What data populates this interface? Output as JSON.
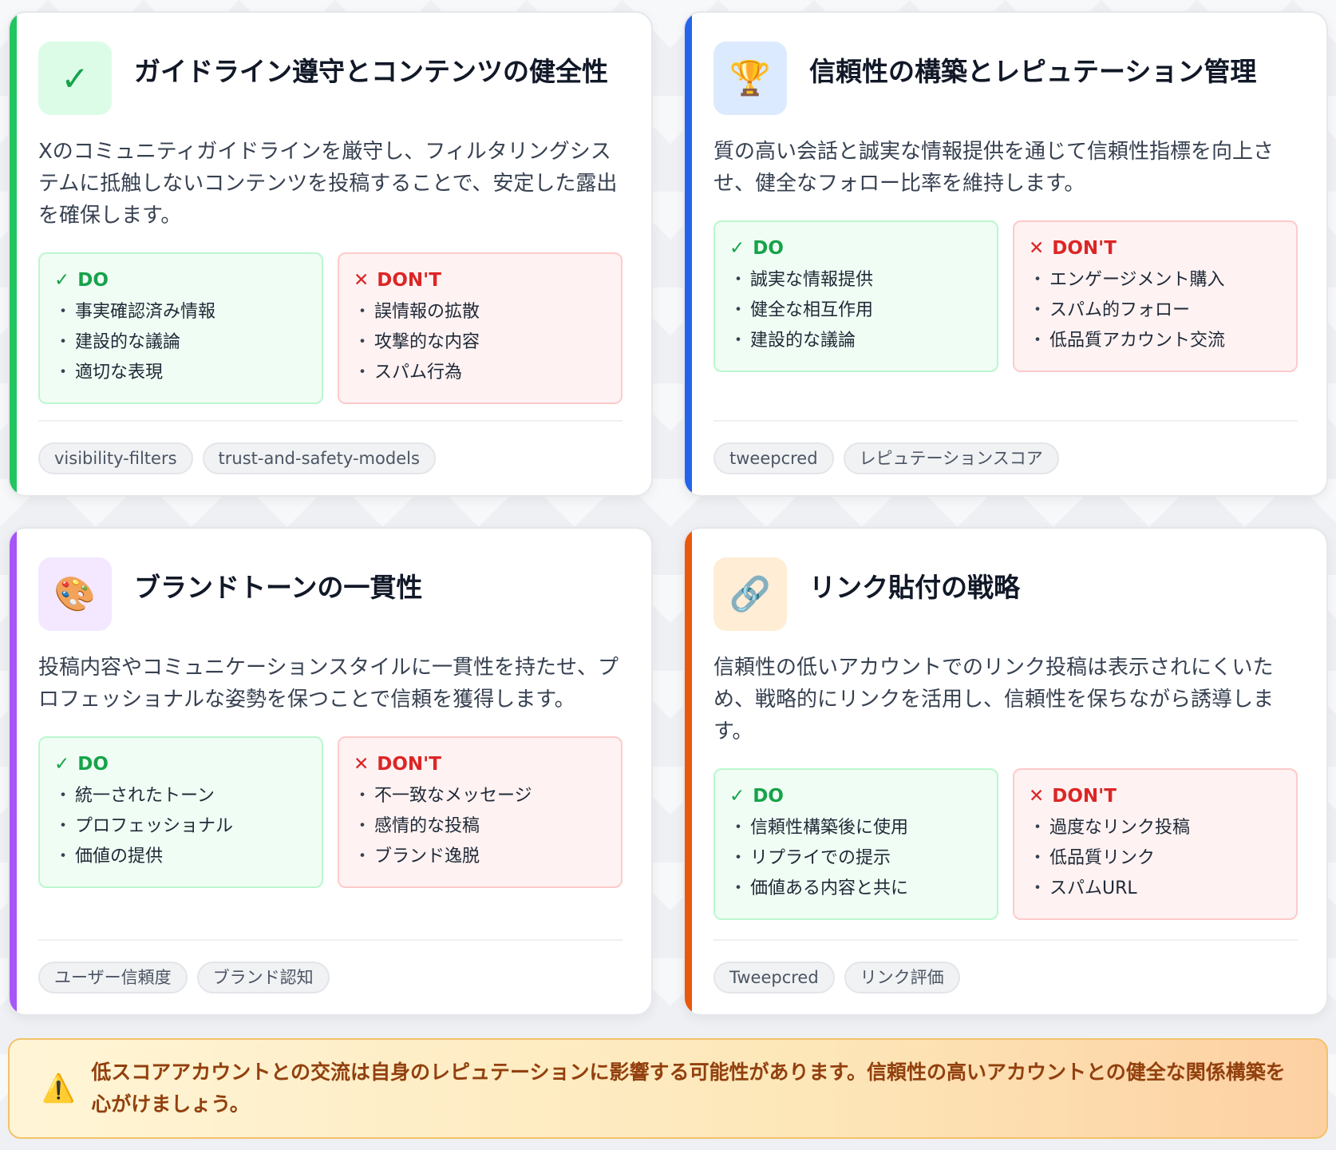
{
  "cards": [
    {
      "title": "ガイドライン遵守とコンテンツの健全性",
      "icon": "✓",
      "icon_name": "check-icon",
      "accent": "#22c55e",
      "icon_bg": "#dcfce7",
      "description": "Xのコミュニティガイドラインを厳守し、フィルタリングシステムに抵触しないコンテンツを投稿することで、安定した露出を確保します。",
      "do_label": "DO",
      "dont_label": "DON'T",
      "do_items": [
        "事実確認済み情報",
        "建設的な議論",
        "適切な表現"
      ],
      "dont_items": [
        "誤情報の拡散",
        "攻撃的な内容",
        "スパム行為"
      ],
      "tags": [
        "visibility-filters",
        "trust-and-safety-models"
      ]
    },
    {
      "title": "信頼性の構築とレピュテーション管理",
      "icon": "🏆",
      "icon_name": "trophy-icon",
      "accent": "#2563eb",
      "icon_bg": "#dbeafe",
      "description": "質の高い会話と誠実な情報提供を通じて信頼性指標を向上させ、健全なフォロー比率を維持します。",
      "do_label": "DO",
      "dont_label": "DON'T",
      "do_items": [
        "誠実な情報提供",
        "健全な相互作用",
        "建設的な議論"
      ],
      "dont_items": [
        "エンゲージメント購入",
        "スパム的フォロー",
        "低品質アカウント交流"
      ],
      "tags": [
        "tweepcred",
        "レピュテーションスコア"
      ]
    },
    {
      "title": "ブランドトーンの一貫性",
      "icon": "🎨",
      "icon_name": "palette-icon",
      "accent": "#a855f7",
      "icon_bg": "#f3e8ff",
      "description": "投稿内容やコミュニケーションスタイルに一貫性を持たせ、プロフェッショナルな姿勢を保つことで信頼を獲得します。",
      "do_label": "DO",
      "dont_label": "DON'T",
      "do_items": [
        "統一されたトーン",
        "プロフェッショナル",
        "価値の提供"
      ],
      "dont_items": [
        "不一致なメッセージ",
        "感情的な投稿",
        "ブランド逸脱"
      ],
      "tags": [
        "ユーザー信頼度",
        "ブランド認知"
      ]
    },
    {
      "title": "リンク貼付の戦略",
      "icon": "🔗",
      "icon_name": "link-icon",
      "accent": "#ea580c",
      "icon_bg": "#ffedd5",
      "description": "信頼性の低いアカウントでのリンク投稿は表示されにくいため、戦略的にリンクを活用し、信頼性を保ちながら誘導します。",
      "do_label": "DO",
      "dont_label": "DON'T",
      "do_items": [
        "信頼性構築後に使用",
        "リプライでの提示",
        "価値ある内容と共に"
      ],
      "dont_items": [
        "過度なリンク投稿",
        "低品質リンク",
        "スパムURL"
      ],
      "tags": [
        "Tweepcred",
        "リンク評価"
      ]
    }
  ],
  "warning": {
    "icon": "⚠️",
    "text": "低スコアアカウントとの交流は自身のレピュテーションに影響する可能性があります。信頼性の高いアカウントとの健全な関係構築を心がけましょう。"
  }
}
